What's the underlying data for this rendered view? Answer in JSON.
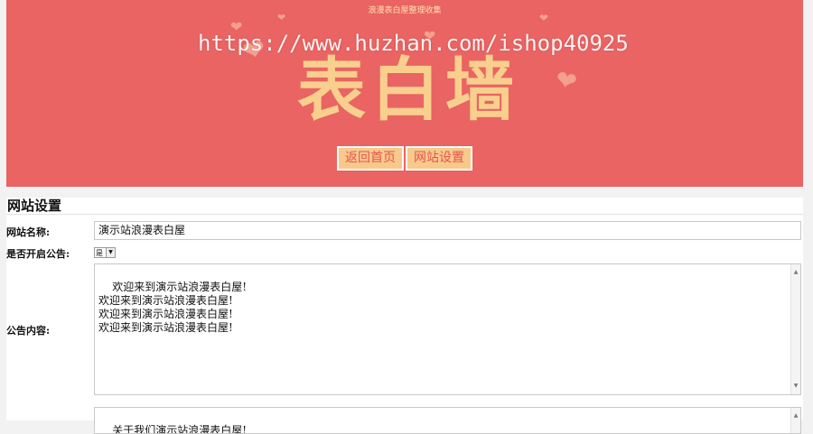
{
  "banner": {
    "tagline": "浪漫表白屋整理收集",
    "watermark": "https://www.huzhan.com/ishop40925",
    "title": "表白墙",
    "nav": [
      {
        "label": "返回首页"
      },
      {
        "label": "网站设置"
      }
    ],
    "colors": {
      "background": "#e96462",
      "title": "#f9cf8e",
      "button_bg": "#f8c98b",
      "button_text": "#e5554f"
    }
  },
  "settings": {
    "title": "网站设置",
    "site_name_label": "网站名称:",
    "site_name_value": "演示站浪漫表白屋",
    "notice_enabled_label": "是否开启公告:",
    "notice_enabled_value": "是",
    "notice_content_label": "公告内容:",
    "notice_content_value": "欢迎来到演示站浪漫表白屋!\n欢迎来到演示站浪漫表白屋!\n欢迎来到演示站浪漫表白屋!\n欢迎来到演示站浪漫表白屋!",
    "about_value": "关于我们演示站浪漫表白屋!"
  },
  "icons": [
    "heart-icon",
    "chevron-down-icon",
    "scroll-up-icon",
    "scroll-down-icon"
  ]
}
